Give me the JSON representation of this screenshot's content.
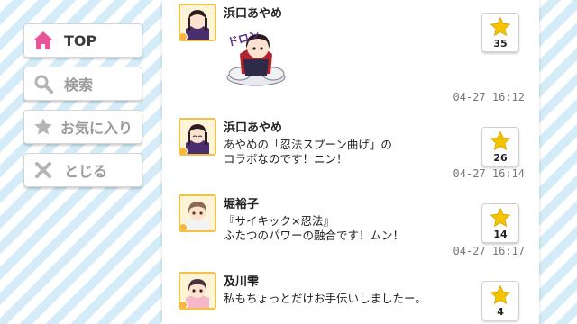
{
  "nav": {
    "items": [
      {
        "label": "TOP",
        "icon": "home-icon",
        "active": true
      },
      {
        "label": "検索",
        "icon": "search-icon",
        "active": false
      },
      {
        "label": "お気に入り",
        "icon": "star-icon",
        "active": false
      },
      {
        "label": "とじる",
        "icon": "close-icon",
        "active": false
      }
    ]
  },
  "colors": {
    "accent_pink": "#e7549a",
    "star_yellow": "#f5c400",
    "inactive_gray": "#b4b4b4"
  },
  "posts": [
    {
      "author": "浜口あやめ",
      "type": "stamp",
      "stamp_text": "ドロン",
      "likes": "35",
      "time": "04-27 16:12"
    },
    {
      "author": "浜口あやめ",
      "type": "text",
      "lines": [
        "あやめの「忍法スプーン曲げ」の",
        "コラボなのです！ニン！"
      ],
      "likes": "26",
      "time": "04-27 16:14"
    },
    {
      "author": "堀裕子",
      "type": "text",
      "lines": [
        "『サイキック×忍法』",
        "ふたつのパワーの融合です！ムン！"
      ],
      "likes": "14",
      "time": "04-27 16:17"
    },
    {
      "author": "及川雫",
      "type": "text",
      "lines": [
        "私もちょっとだけお手伝いしましたー。"
      ],
      "likes": "4",
      "time": ""
    }
  ]
}
